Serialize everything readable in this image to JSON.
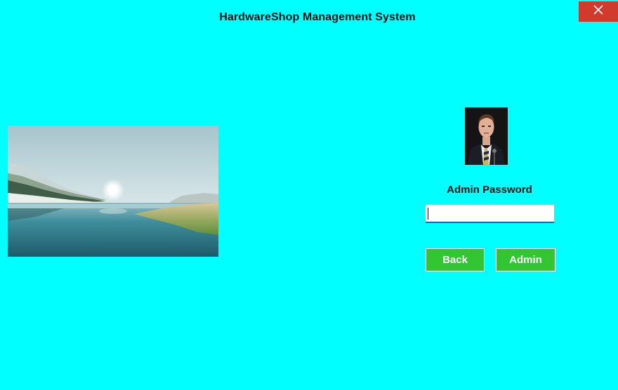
{
  "window": {
    "title": "HardwareShop Management System",
    "close_icon": "close-icon"
  },
  "login": {
    "password_label": "Admin Password",
    "password_value": "",
    "back_label": "Back",
    "admin_label": "Admin"
  },
  "colors": {
    "background": "#00ffff",
    "close_button": "#d23a2c",
    "button_green": "#33c633",
    "input_underline": "#1f5fb8"
  },
  "images": {
    "landscape": "landscape-photo",
    "avatar": "admin-avatar-photo"
  }
}
